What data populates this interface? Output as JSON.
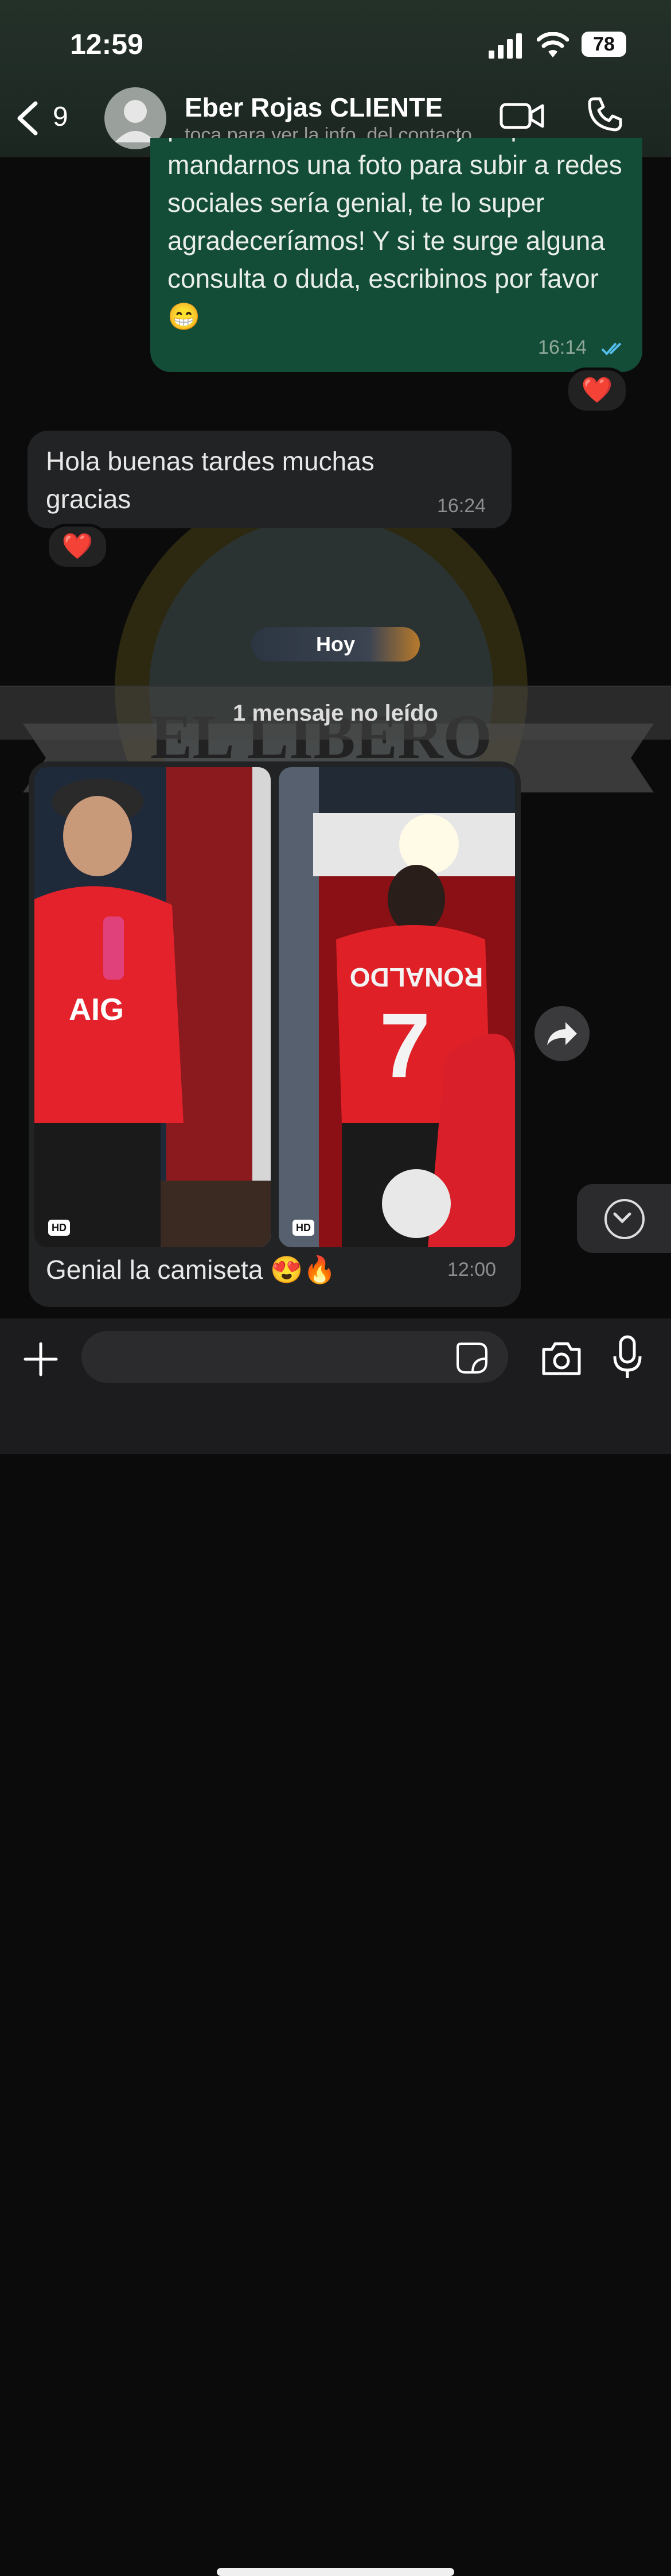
{
  "status_bar": {
    "time": "12:59",
    "battery": "78"
  },
  "header": {
    "back_count": "9",
    "contact_name": "Eber Rojas CLIENTE",
    "contact_subtitle": "toca para ver la info. del contacto"
  },
  "messages": {
    "outgoing": {
      "text": "personal de encomienda). Si podes mandarnos una foto para subir a redes sociales sería genial, te lo super agradeceríamos! Y si te surge alguna consulta o duda, escribinos por favor 😁",
      "time": "16:14",
      "reaction": "❤️"
    },
    "incoming": {
      "text": "Hola buenas tardes muchas gracias",
      "time": "16:24",
      "reaction": "❤️"
    },
    "date_chip": "Hoy",
    "unread_label": "1 mensaje no leído",
    "media": {
      "photo_badges": [
        "HD",
        "HD"
      ],
      "caption": "Genial la camiseta 😍🔥",
      "time": "12:00",
      "shirt_text_1": "AIG",
      "shirt_text_2": "RONALDO",
      "shirt_number": "7"
    }
  },
  "composer": {
    "placeholder": ""
  },
  "colors": {
    "outgoing_bubble": "#144d37",
    "incoming_bubble": "#222325",
    "read_ticks": "#53bdeb"
  }
}
